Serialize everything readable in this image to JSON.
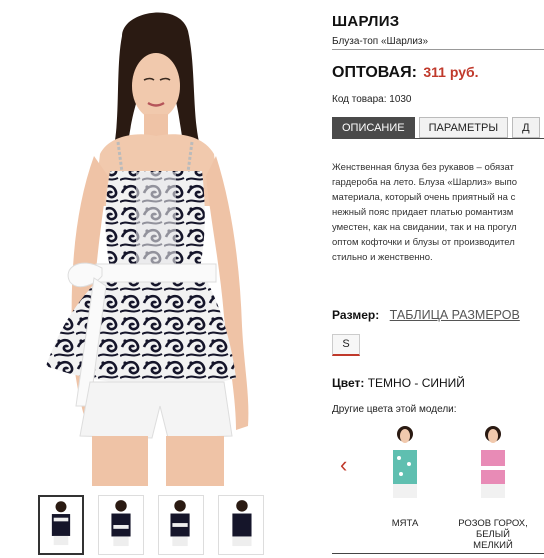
{
  "product": {
    "title": "ШАРЛИЗ",
    "subtitle": "Блуза-топ «Шарлиз»",
    "price_label": "ОПТОВАЯ:",
    "price_value": "311 руб.",
    "sku": "Код товара: 1030"
  },
  "tabs": [
    {
      "label": "ОПИСАНИЕ",
      "active": true
    },
    {
      "label": "ПАРАМЕТРЫ",
      "active": false
    },
    {
      "label": "Д",
      "active": false
    }
  ],
  "description_lines": [
    "Женственная блуза без рукавов – обязат",
    "гардероба на лето. Блуза «Шарлиз» выпо",
    "материала, который очень приятный на с",
    "нежный пояс придает платью романтизм",
    "уместен, как на свидании, так и на прогул",
    "оптом кофточки и блузы от производител",
    "стильно и женственно."
  ],
  "size": {
    "label": "Размер:",
    "table_link": "ТАБЛИЦА РАЗМЕРОВ",
    "options": [
      "S"
    ]
  },
  "color": {
    "label": "Цвет:",
    "value": "ТЕМНО - СИНИЙ",
    "other_colors_label": "Другие цвета этой модели:"
  },
  "variants": [
    {
      "label_line1": "МЯТА",
      "label_line2": "",
      "accent": "#5fbfb0"
    },
    {
      "label_line1": "РОЗОВ ГОРОХ,",
      "label_line2": "БЕЛЫЙ МЕЛКИЙ",
      "accent": "#e88bb6"
    }
  ],
  "icons": {
    "prev_arrow": "chevron-left-icon",
    "prev_arrow_glyph": "‹"
  },
  "colors": {
    "price": "#c0392b",
    "active_tab": "#4a4a4a",
    "top_pattern_dark": "#15152a"
  }
}
